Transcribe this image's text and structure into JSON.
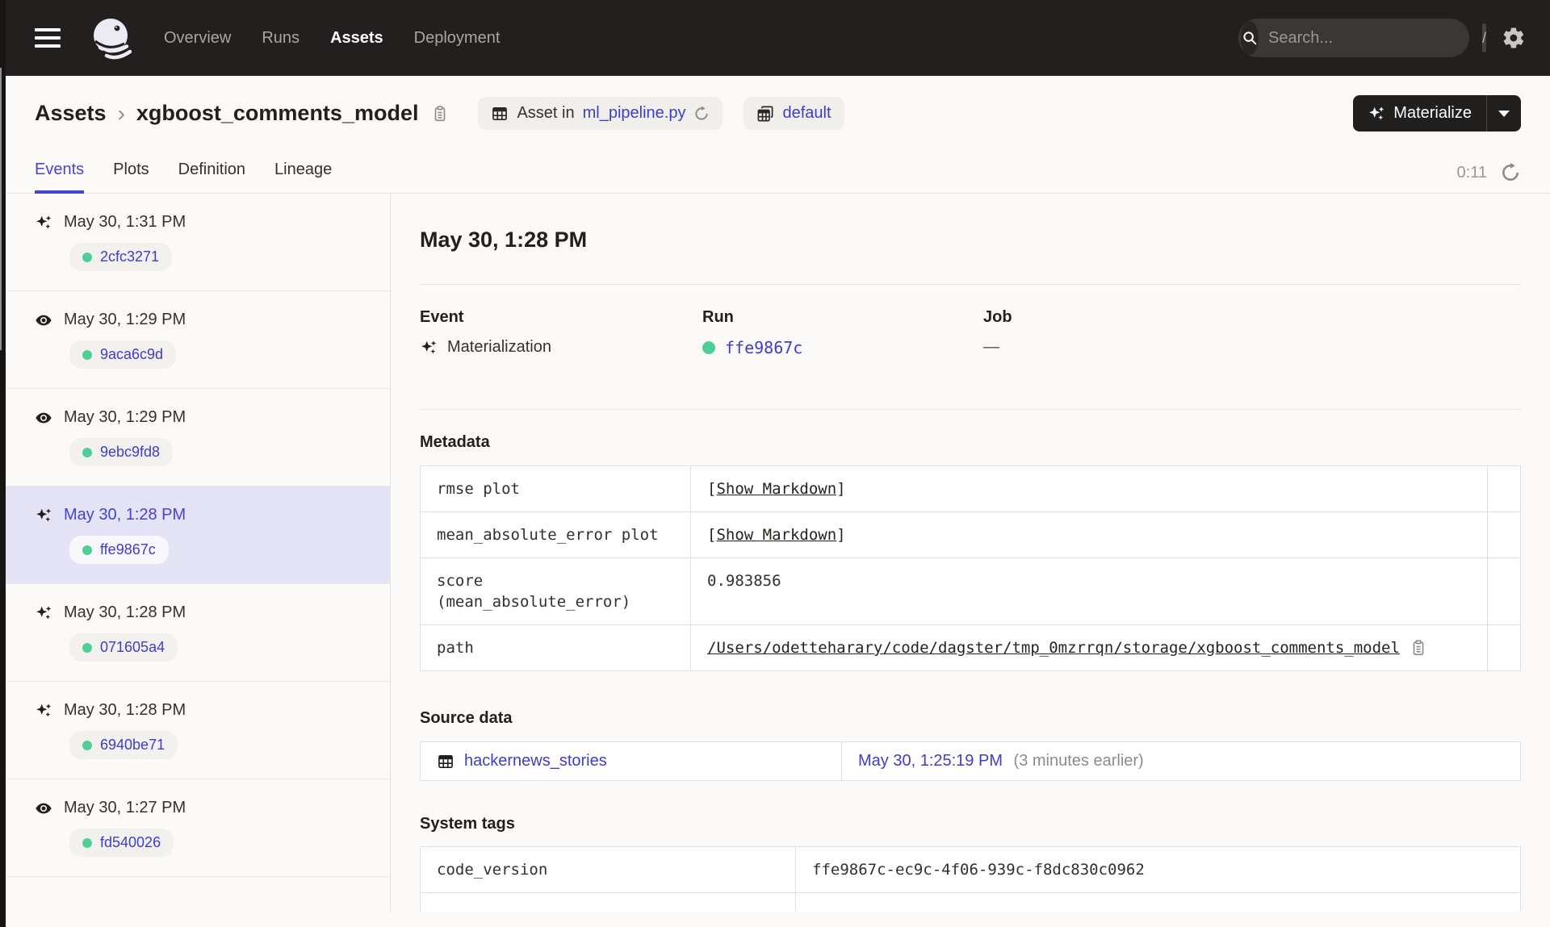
{
  "colors": {
    "accent": "#4A44D6",
    "link": "#403CC9",
    "success_green": "#4FCE97",
    "nav_bg": "#221F1E",
    "selected_bg": "#E5E3F6"
  },
  "nav": {
    "links": [
      {
        "label": "Overview",
        "active": false
      },
      {
        "label": "Runs",
        "active": false
      },
      {
        "label": "Assets",
        "active": true
      },
      {
        "label": "Deployment",
        "active": false
      }
    ],
    "search": {
      "placeholder": "Search...",
      "shortcut": "/"
    }
  },
  "header": {
    "breadcrumb": {
      "parent": "Assets",
      "separator": "›",
      "current": "xgboost_comments_model"
    },
    "asset_location_badge": {
      "prefix": "Asset in",
      "file": "ml_pipeline.py"
    },
    "repo_badge": {
      "label": "default"
    },
    "materialize_button": {
      "label": "Materialize"
    }
  },
  "tabs": {
    "items": [
      {
        "label": "Events",
        "active": true
      },
      {
        "label": "Plots",
        "active": false
      },
      {
        "label": "Definition",
        "active": false
      },
      {
        "label": "Lineage",
        "active": false
      }
    ],
    "refresh_timer": "0:11"
  },
  "sidebar": {
    "events": [
      {
        "icon": "materialization-sparkle-icon",
        "time": "May 30, 1:31 PM",
        "run_id": "2cfc3271",
        "selected": false
      },
      {
        "icon": "observation-eye-icon",
        "time": "May 30, 1:29 PM",
        "run_id": "9aca6c9d",
        "selected": false
      },
      {
        "icon": "observation-eye-icon",
        "time": "May 30, 1:29 PM",
        "run_id": "9ebc9fd8",
        "selected": false
      },
      {
        "icon": "materialization-sparkle-icon",
        "time": "May 30, 1:28 PM",
        "run_id": "ffe9867c",
        "selected": true
      },
      {
        "icon": "materialization-sparkle-icon",
        "time": "May 30, 1:28 PM",
        "run_id": "071605a4",
        "selected": false
      },
      {
        "icon": "materialization-sparkle-icon",
        "time": "May 30, 1:28 PM",
        "run_id": "6940be71",
        "selected": false
      },
      {
        "icon": "observation-eye-icon",
        "time": "May 30, 1:27 PM",
        "run_id": "fd540026",
        "selected": false
      }
    ]
  },
  "detail": {
    "title": "May 30, 1:28 PM",
    "event": {
      "label": "Event",
      "value": "Materialization"
    },
    "run": {
      "label": "Run",
      "value": "ffe9867c"
    },
    "job": {
      "label": "Job",
      "value": "—"
    },
    "metadata": {
      "heading": "Metadata",
      "rows": [
        {
          "key": "rmse plot",
          "bracket_open": "[",
          "link": "Show Markdown",
          "bracket_close": "]"
        },
        {
          "key": "mean_absolute_error plot",
          "bracket_open": "[",
          "link": "Show Markdown",
          "bracket_close": "]"
        },
        {
          "key": "score\n(mean_absolute_error)",
          "value": "0.983856"
        },
        {
          "key": "path",
          "link": "/Users/odetteharary/code/dagster/tmp_0mzrrqn/storage/xgboost_comments_model"
        }
      ]
    },
    "source_data": {
      "heading": "Source data",
      "asset_name": "hackernews_stories",
      "timestamp": "May 30, 1:25:19 PM",
      "relative_note": "(3 minutes earlier)"
    },
    "system_tags": {
      "heading": "System tags",
      "rows": [
        {
          "key": "code_version",
          "value": "ffe9867c-ec9c-4f06-939c-f8dc830c0962"
        }
      ]
    }
  }
}
